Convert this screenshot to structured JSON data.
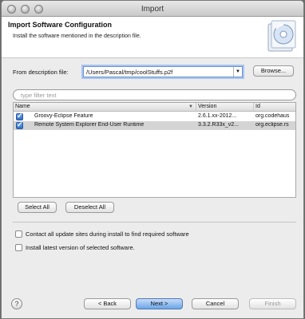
{
  "window": {
    "title": "Import"
  },
  "header": {
    "title": "Import Software Configuration",
    "description": "Install the software mentioned in the description file."
  },
  "source": {
    "label": "From description file:",
    "value": "/Users/Pascal/tmp/coolStuffs.p2f",
    "browse_label": "Browse..."
  },
  "filter": {
    "placeholder": "type filter text"
  },
  "table": {
    "columns": [
      "Name",
      "Version",
      "Id"
    ],
    "rows": [
      {
        "checked": true,
        "name": "Groovy-Eclipse Feature",
        "version": "2.6.1.xx-2012...",
        "id": "org.codehaus"
      },
      {
        "checked": true,
        "name": "Remote System Explorer End-User Runtime",
        "version": "3.3.2.R33x_v2...",
        "id": "org.eclipse.rs"
      }
    ]
  },
  "selection": {
    "select_all": "Select All",
    "deselect_all": "Deselect All"
  },
  "options": [
    {
      "checked": false,
      "label": "Contact all update sites during install to find required software"
    },
    {
      "checked": false,
      "label": "Install latest version of selected software."
    }
  ],
  "footer": {
    "help": "?",
    "back": "< Back",
    "next": "Next >",
    "cancel": "Cancel",
    "finish": "Finish"
  },
  "colors": {
    "accent": "#6aa5ea",
    "selected_row": "#d4d4d4"
  },
  "icons": [
    "help-icon",
    "dropdown-arrow-icon",
    "sort-arrow-icon",
    "install-cd-icon"
  ]
}
